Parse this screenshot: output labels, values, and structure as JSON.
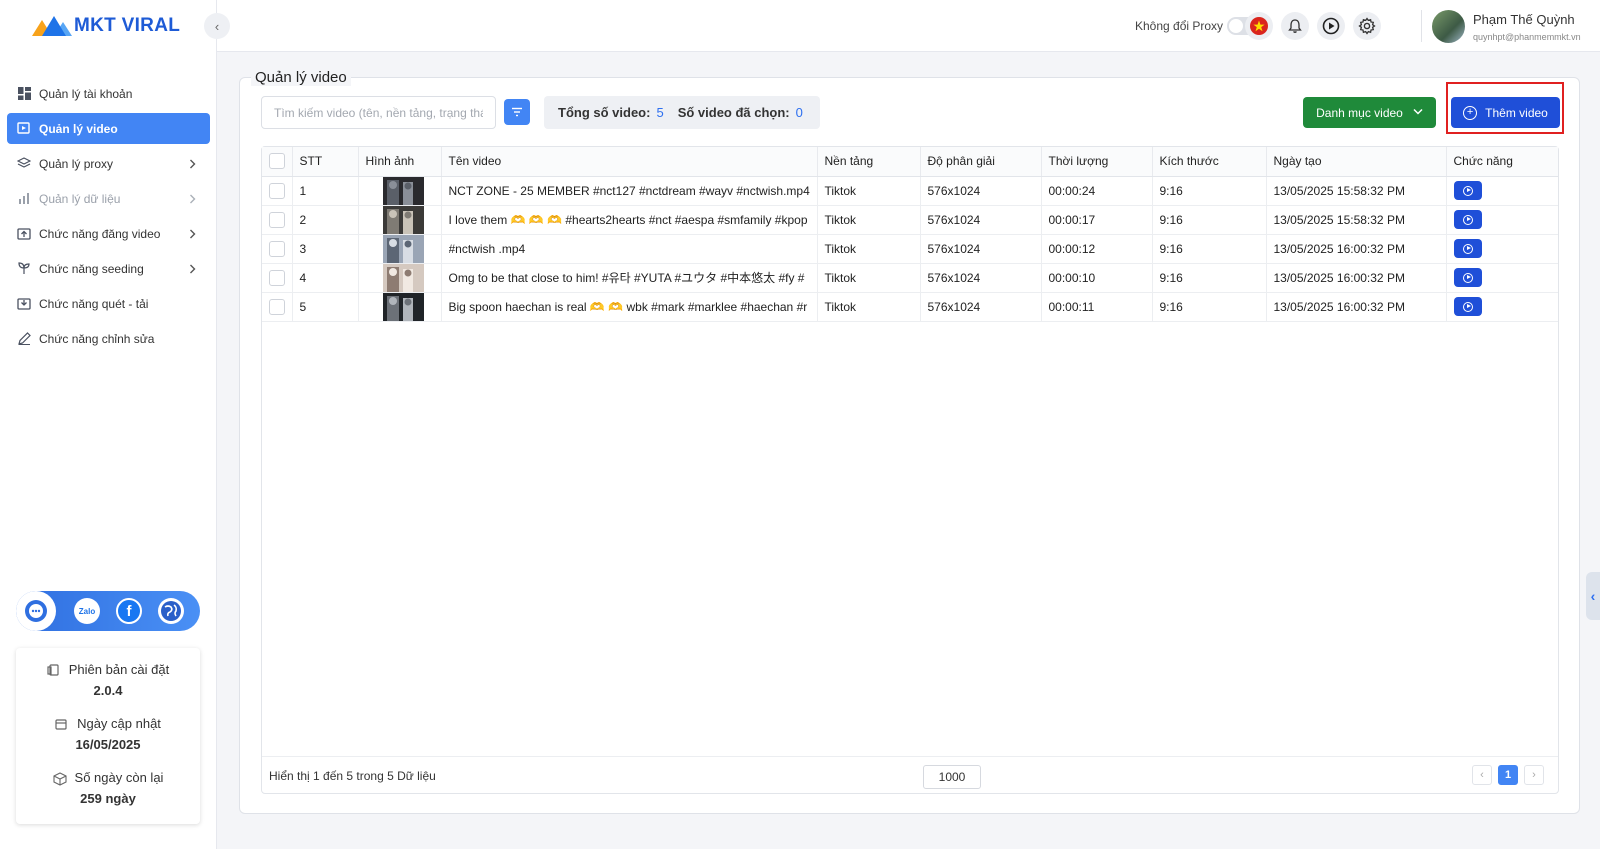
{
  "brand": {
    "name": "MKT VIRAL",
    "colors": {
      "primary": "#4285f4",
      "blue_dark": "#1f4fd8",
      "green": "#1f8a3a",
      "highlight_red": "#e02020"
    }
  },
  "sidebar": {
    "collapse_icon": "chevron-left-icon",
    "items": [
      {
        "label": "Quản lý tài khoản",
        "icon": "dashboard-icon",
        "active": false,
        "disabled": false,
        "chevron": false
      },
      {
        "label": "Quản lý video",
        "icon": "video-icon",
        "active": true,
        "disabled": false,
        "chevron": false
      },
      {
        "label": "Quản lý proxy",
        "icon": "layers-icon",
        "active": false,
        "disabled": false,
        "chevron": true
      },
      {
        "label": "Quản lý dữ liệu",
        "icon": "chart-icon",
        "active": false,
        "disabled": true,
        "chevron": true
      },
      {
        "label": "Chức năng đăng video",
        "icon": "upload-icon",
        "active": false,
        "disabled": false,
        "chevron": true
      },
      {
        "label": "Chức năng seeding",
        "icon": "seed-icon",
        "active": false,
        "disabled": false,
        "chevron": true
      },
      {
        "label": "Chức năng quét - tải",
        "icon": "download-icon",
        "active": false,
        "disabled": false,
        "chevron": false
      },
      {
        "label": "Chức năng chỉnh sửa",
        "icon": "pencil-icon",
        "active": false,
        "disabled": false,
        "chevron": false
      }
    ],
    "social": [
      "support-chat-icon",
      "zalo-icon",
      "facebook-icon",
      "globe-icon"
    ],
    "info": {
      "version_label": "Phiên bản cài đặt",
      "version_value": "2.0.4",
      "update_label": "Ngày cập nhật",
      "update_value": "16/05/2025",
      "remaining_label": "Số ngày còn lại",
      "remaining_value": "259 ngày"
    }
  },
  "header": {
    "proxy_toggle_label": "Không đổi Proxy",
    "proxy_toggle_on": false,
    "icons": [
      "vietnam-flag-icon",
      "bell-icon",
      "play-circle-icon",
      "gear-icon"
    ],
    "user": {
      "name": "Phạm Thế Quỳnh",
      "email": "quynhpt@phanmemmkt.vn"
    }
  },
  "page": {
    "title": "Quản lý video",
    "search_placeholder": "Tìm kiếm video (tên, nền tảng, trạng thái)",
    "stats": {
      "total_label": "Tổng số video:",
      "total_value": "5",
      "selected_label": "Số video đã chọn:",
      "selected_value": "0"
    },
    "category_button": "Danh mục video",
    "add_button": "Thêm video"
  },
  "table": {
    "headers": [
      "",
      "STT",
      "Hình ảnh",
      "Tên video",
      "Nền tảng",
      "Độ phân giải",
      "Thời lượng",
      "Kích thước",
      "Ngày tạo",
      "Chức năng"
    ],
    "rows": [
      {
        "stt": "1",
        "name": "NCT ZONE - 25 MEMBER #nct127 #nctdream #wayv #nctwish.mp4",
        "platform": "Tiktok",
        "resolution": "576x1024",
        "duration": "00:00:24",
        "size": "9:16",
        "created": "13/05/2025 15:58:32 PM"
      },
      {
        "stt": "2",
        "name": "I love them 🫶 🫶 🫶 #hearts2hearts #nct #aespa #smfamily #kpop",
        "platform": "Tiktok",
        "resolution": "576x1024",
        "duration": "00:00:17",
        "size": "9:16",
        "created": "13/05/2025 15:58:32 PM"
      },
      {
        "stt": "3",
        "name": "#nctwish .mp4",
        "platform": "Tiktok",
        "resolution": "576x1024",
        "duration": "00:00:12",
        "size": "9:16",
        "created": "13/05/2025 16:00:32 PM"
      },
      {
        "stt": "4",
        "name": "Omg to be that close to him! #유타 #YUTA #ユウタ #中本悠太 #fy #",
        "platform": "Tiktok",
        "resolution": "576x1024",
        "duration": "00:00:10",
        "size": "9:16",
        "created": "13/05/2025 16:00:32 PM"
      },
      {
        "stt": "5",
        "name": "Big spoon haechan is real 🫶 🫶 wbk #mark #marklee #haechan #r",
        "platform": "Tiktok",
        "resolution": "576x1024",
        "duration": "00:00:11",
        "size": "9:16",
        "created": "13/05/2025 16:00:32 PM"
      }
    ],
    "footer": {
      "showing": "Hiển thị 1 đến 5 trong 5 Dữ liệu",
      "page_size": "1000",
      "current_page": "1"
    }
  }
}
